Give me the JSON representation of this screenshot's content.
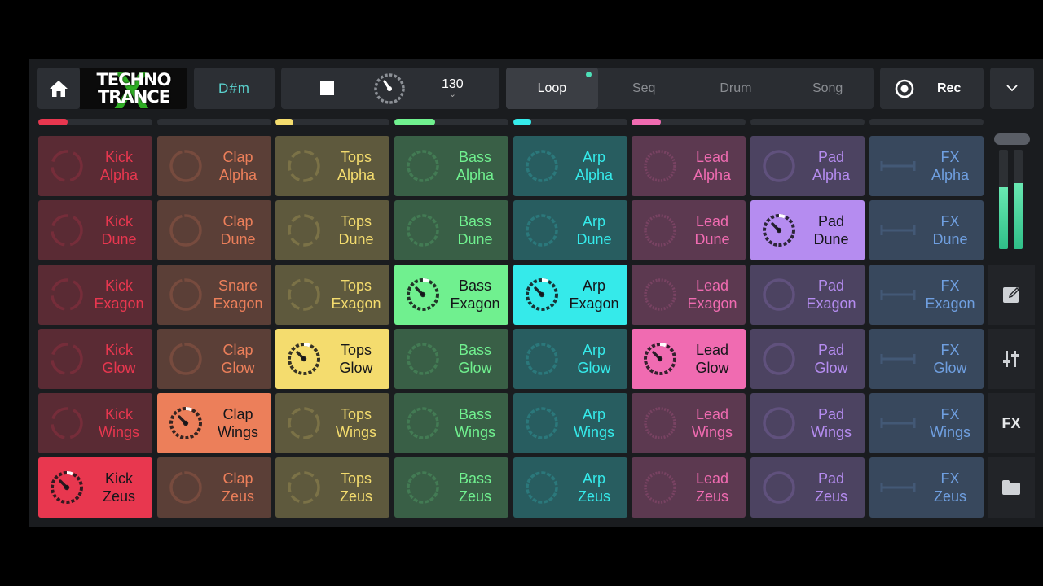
{
  "header": {
    "logo_line1": "TECHNO",
    "logo_line2": "TRANCE",
    "logo_mark": "X",
    "key": "D#m",
    "bpm": "130",
    "bpm_chevron": "⌄",
    "modes": [
      "Loop",
      "Seq",
      "Drum",
      "Song"
    ],
    "active_mode": "Loop",
    "rec_label": "Rec",
    "more_chevron": "⌄"
  },
  "colors": {
    "kick": "#e8374f",
    "clap": "#ec7f5a",
    "tops": "#f4dc6e",
    "bass": "#70f08f",
    "arp": "#35eaea",
    "lead": "#f06bb1",
    "pad": "#b58cf0",
    "fx": "#6f9fe0"
  },
  "columns": [
    {
      "key": "kick",
      "progress": 0.26
    },
    {
      "key": "clap",
      "progress": 0
    },
    {
      "key": "tops",
      "progress": 0.16
    },
    {
      "key": "bass",
      "progress": 0.36
    },
    {
      "key": "arp",
      "progress": 0.16
    },
    {
      "key": "lead",
      "progress": 0.26
    },
    {
      "key": "pad",
      "progress": 0
    },
    {
      "key": "fx",
      "progress": 0
    }
  ],
  "pads": [
    [
      {
        "line1": "Kick",
        "line2": "Alpha"
      },
      {
        "line1": "Clap",
        "line2": "Alpha"
      },
      {
        "line1": "Tops",
        "line2": "Alpha"
      },
      {
        "line1": "Bass",
        "line2": "Alpha"
      },
      {
        "line1": "Arp",
        "line2": "Alpha"
      },
      {
        "line1": "Lead",
        "line2": "Alpha"
      },
      {
        "line1": "Pad",
        "line2": "Alpha"
      },
      {
        "line1": "FX",
        "line2": "Alpha"
      }
    ],
    [
      {
        "line1": "Kick",
        "line2": "Dune"
      },
      {
        "line1": "Clap",
        "line2": "Dune"
      },
      {
        "line1": "Tops",
        "line2": "Dune"
      },
      {
        "line1": "Bass",
        "line2": "Dune"
      },
      {
        "line1": "Arp",
        "line2": "Dune"
      },
      {
        "line1": "Lead",
        "line2": "Dune"
      },
      {
        "line1": "Pad",
        "line2": "Dune",
        "active": true
      },
      {
        "line1": "FX",
        "line2": "Dune"
      }
    ],
    [
      {
        "line1": "Kick",
        "line2": "Exagon"
      },
      {
        "line1": "Snare",
        "line2": "Exagon"
      },
      {
        "line1": "Tops",
        "line2": "Exagon"
      },
      {
        "line1": "Bass",
        "line2": "Exagon",
        "active": true
      },
      {
        "line1": "Arp",
        "line2": "Exagon",
        "active": true
      },
      {
        "line1": "Lead",
        "line2": "Exagon"
      },
      {
        "line1": "Pad",
        "line2": "Exagon"
      },
      {
        "line1": "FX",
        "line2": "Exagon"
      }
    ],
    [
      {
        "line1": "Kick",
        "line2": "Glow"
      },
      {
        "line1": "Clap",
        "line2": "Glow"
      },
      {
        "line1": "Tops",
        "line2": "Glow",
        "active": true
      },
      {
        "line1": "Bass",
        "line2": "Glow"
      },
      {
        "line1": "Arp",
        "line2": "Glow"
      },
      {
        "line1": "Lead",
        "line2": "Glow",
        "active": true
      },
      {
        "line1": "Pad",
        "line2": "Glow"
      },
      {
        "line1": "FX",
        "line2": "Glow"
      }
    ],
    [
      {
        "line1": "Kick",
        "line2": "Wings"
      },
      {
        "line1": "Clap",
        "line2": "Wings",
        "active": true
      },
      {
        "line1": "Tops",
        "line2": "Wings"
      },
      {
        "line1": "Bass",
        "line2": "Wings"
      },
      {
        "line1": "Arp",
        "line2": "Wings"
      },
      {
        "line1": "Lead",
        "line2": "Wings"
      },
      {
        "line1": "Pad",
        "line2": "Wings"
      },
      {
        "line1": "FX",
        "line2": "Wings"
      }
    ],
    [
      {
        "line1": "Kick",
        "line2": "Zeus",
        "active": true
      },
      {
        "line1": "Clap",
        "line2": "Zeus"
      },
      {
        "line1": "Tops",
        "line2": "Zeus"
      },
      {
        "line1": "Bass",
        "line2": "Zeus"
      },
      {
        "line1": "Arp",
        "line2": "Zeus"
      },
      {
        "line1": "Lead",
        "line2": "Zeus"
      },
      {
        "line1": "Pad",
        "line2": "Zeus"
      },
      {
        "line1": "FX",
        "line2": "Zeus"
      }
    ]
  ],
  "sidebar": {
    "fx_label": "FX",
    "vu_levels": [
      0.62,
      0.66
    ],
    "icons": [
      "edit-icon",
      "mixer-sliders-icon",
      "fx-icon",
      "folder-icon"
    ]
  }
}
